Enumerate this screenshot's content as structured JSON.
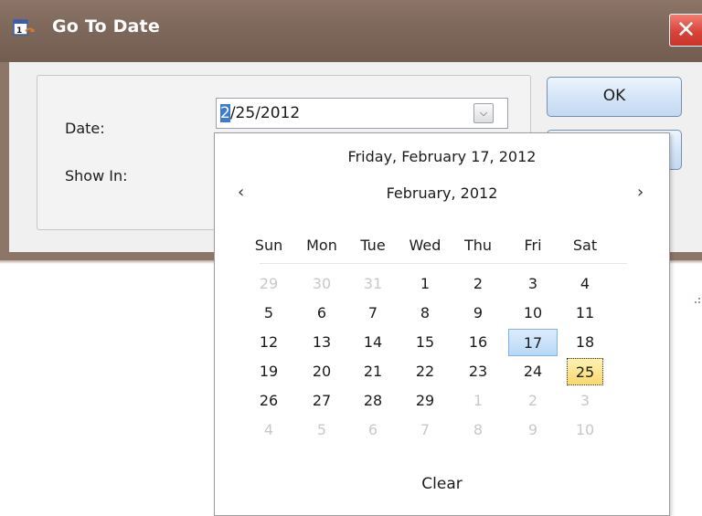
{
  "window": {
    "title": "Go To Date",
    "close_glyph": "✕",
    "icon": "calendar-goto-icon"
  },
  "form": {
    "date_label": "Date:",
    "date_value_sel": "2",
    "date_value_rest": "/25/2012",
    "show_in_label": "Show In:",
    "dropdown_glyph": "⌵"
  },
  "buttons": {
    "ok": "OK",
    "cancel": ""
  },
  "calendar": {
    "today_text": "Friday, February 17, 2012",
    "month_text": "February, 2012",
    "prev_glyph": "‹",
    "next_glyph": "›",
    "days_of_week": [
      "Sun",
      "Mon",
      "Tue",
      "Wed",
      "Thu",
      "Fri",
      "Sat"
    ],
    "weeks": [
      [
        "29",
        "30",
        "31",
        "1",
        "2",
        "3",
        "4"
      ],
      [
        "5",
        "6",
        "7",
        "8",
        "9",
        "10",
        "11"
      ],
      [
        "12",
        "13",
        "14",
        "15",
        "16",
        "17",
        "18"
      ],
      [
        "19",
        "20",
        "21",
        "22",
        "23",
        "24",
        "25"
      ],
      [
        "26",
        "27",
        "28",
        "29",
        "1",
        "2",
        "3"
      ],
      [
        "4",
        "5",
        "6",
        "7",
        "8",
        "9",
        "10"
      ]
    ],
    "other_month": [
      [
        true,
        true,
        true,
        false,
        false,
        false,
        false
      ],
      [
        false,
        false,
        false,
        false,
        false,
        false,
        false
      ],
      [
        false,
        false,
        false,
        false,
        false,
        false,
        false
      ],
      [
        false,
        false,
        false,
        false,
        false,
        false,
        false
      ],
      [
        false,
        false,
        false,
        false,
        true,
        true,
        true
      ],
      [
        true,
        true,
        true,
        true,
        true,
        true,
        true
      ]
    ],
    "today": "17",
    "selected": "25",
    "clear_label": "Clear",
    "colors": {
      "today_bg": "#c6e0fa",
      "selected_bg": "#fbe08a",
      "other_month_text": "#c8c8c8"
    }
  }
}
